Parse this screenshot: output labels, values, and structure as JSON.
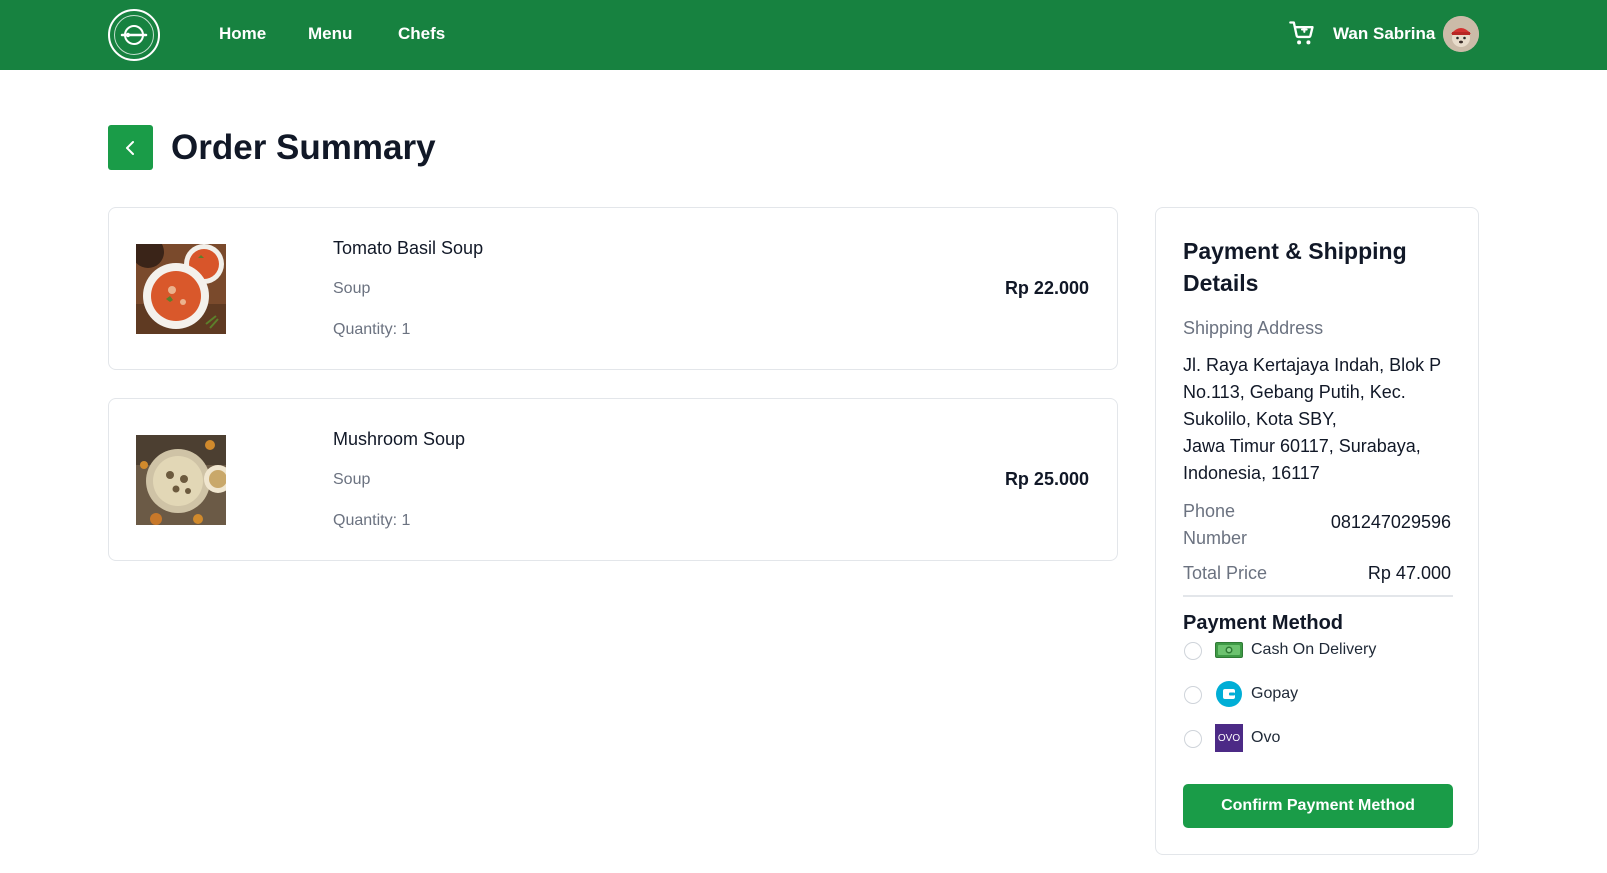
{
  "header": {
    "logo_icon": "restaurant-plate-logo",
    "nav": [
      {
        "label": "Home"
      },
      {
        "label": "Menu"
      },
      {
        "label": "Chefs"
      }
    ],
    "cart_icon": "cart-icon",
    "user_name": "Wan Sabrina",
    "brand_color": "#178240"
  },
  "page": {
    "back_icon": "chevron-left-icon",
    "title": "Order Summary"
  },
  "orders": [
    {
      "name": "Tomato Basil Soup",
      "category": "Soup",
      "quantity": "Quantity: 1",
      "price": "Rp 22.000"
    },
    {
      "name": "Mushroom Soup",
      "category": "Soup",
      "quantity": "Quantity: 1",
      "price": "Rp 25.000"
    }
  ],
  "payment": {
    "title": "Payment & Shipping Details",
    "shipping_label": "Shipping Address",
    "shipping_address": "Jl. Raya Kertajaya Indah, Blok P No.113, Gebang Putih, Kec. Sukolilo, Kota SBY,\nJawa Timur 60117, Surabaya, Indonesia, 16117",
    "phone_label": "Phone Number",
    "phone_value": "081247029596",
    "total_label": "Total Price",
    "total_value": "Rp 47.000",
    "method_title": "Payment Method",
    "methods": [
      {
        "label": "Cash On Delivery",
        "icon": "cash-icon",
        "selected": false
      },
      {
        "label": "Gopay",
        "icon": "gopay-wallet-icon",
        "selected": false
      },
      {
        "label": "Ovo",
        "icon": "ovo-icon",
        "icon_text": "OVO",
        "selected": false
      }
    ],
    "confirm_label": "Confirm Payment Method",
    "accent_color": "#1a9c48"
  }
}
